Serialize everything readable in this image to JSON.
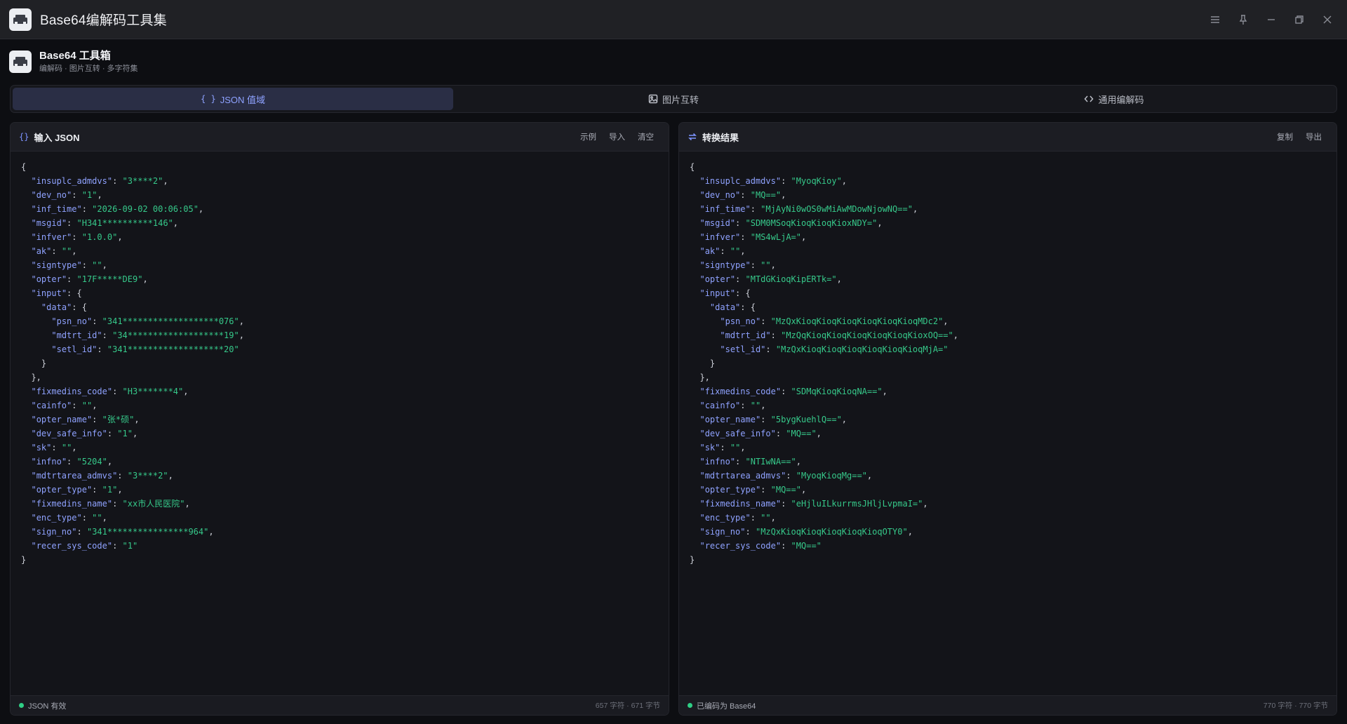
{
  "window": {
    "title": "Base64编解码工具集",
    "controls": [
      "menu-icon",
      "pin-icon",
      "minimize-icon",
      "restore-icon",
      "close-icon"
    ]
  },
  "header": {
    "title": "Base64 工具箱",
    "subtitle": "编解码 · 图片互转 · 多字符集"
  },
  "tabs": [
    {
      "label": "JSON 值域",
      "icon": "braces-icon",
      "active": true
    },
    {
      "label": "图片互转",
      "icon": "image-icon",
      "active": false
    },
    {
      "label": "通用编解码",
      "icon": "code-icon",
      "active": false
    }
  ],
  "left_panel": {
    "icon": "braces-icon",
    "title": "输入 JSON",
    "actions": [
      "示例",
      "导入",
      "清空"
    ],
    "status": "JSON 有效",
    "stats": "657 字符 · 671 字节",
    "lines": [
      {
        "indent": 0,
        "text": "{"
      },
      {
        "indent": 1,
        "key": "insuplc_admdvs",
        "value": "3****2",
        "tail": ","
      },
      {
        "indent": 1,
        "key": "dev_no",
        "value": "1",
        "tail": ","
      },
      {
        "indent": 1,
        "key": "inf_time",
        "value": "2026-09-02 00:06:05",
        "tail": ","
      },
      {
        "indent": 1,
        "key": "msgid",
        "value": "H341**********146",
        "tail": ","
      },
      {
        "indent": 1,
        "key": "infver",
        "value": "1.0.0",
        "tail": ","
      },
      {
        "indent": 1,
        "key": "ak",
        "value": "",
        "tail": ","
      },
      {
        "indent": 1,
        "key": "signtype",
        "value": "",
        "tail": ","
      },
      {
        "indent": 1,
        "key": "opter",
        "value": "17F*****DE9",
        "tail": ","
      },
      {
        "indent": 1,
        "key": "input",
        "open": "{"
      },
      {
        "indent": 2,
        "key": "data",
        "open": "{"
      },
      {
        "indent": 3,
        "key": "psn_no",
        "value": "341*******************076",
        "tail": ","
      },
      {
        "indent": 3,
        "key": "mdtrt_id",
        "value": "34*******************19",
        "tail": ","
      },
      {
        "indent": 3,
        "key": "setl_id",
        "value": "341*******************20"
      },
      {
        "indent": 2,
        "text": "}"
      },
      {
        "indent": 1,
        "text": "},"
      },
      {
        "indent": 1,
        "key": "fixmedins_code",
        "value": "H3*******4",
        "tail": ","
      },
      {
        "indent": 1,
        "key": "cainfo",
        "value": "",
        "tail": ","
      },
      {
        "indent": 1,
        "key": "opter_name",
        "value": "张*硕",
        "tail": ","
      },
      {
        "indent": 1,
        "key": "dev_safe_info",
        "value": "1",
        "tail": ","
      },
      {
        "indent": 1,
        "key": "sk",
        "value": "",
        "tail": ","
      },
      {
        "indent": 1,
        "key": "infno",
        "value": "5204",
        "tail": ","
      },
      {
        "indent": 1,
        "key": "mdtrtarea_admvs",
        "value": "3****2",
        "tail": ","
      },
      {
        "indent": 1,
        "key": "opter_type",
        "value": "1",
        "tail": ","
      },
      {
        "indent": 1,
        "key": "fixmedins_name",
        "value": "xx市人民医院",
        "tail": ","
      },
      {
        "indent": 1,
        "key": "enc_type",
        "value": "",
        "tail": ","
      },
      {
        "indent": 1,
        "key": "sign_no",
        "value": "341****************964",
        "tail": ","
      },
      {
        "indent": 1,
        "key": "recer_sys_code",
        "value": "1"
      },
      {
        "indent": 0,
        "text": "}"
      }
    ]
  },
  "right_panel": {
    "icon": "swap-icon",
    "title": "转换结果",
    "actions": [
      "复制",
      "导出"
    ],
    "status": "已编码为 Base64",
    "stats": "770 字符 · 770 字节",
    "lines": [
      {
        "indent": 0,
        "text": "{"
      },
      {
        "indent": 1,
        "key": "insuplc_admdvs",
        "value": "MyoqKioy",
        "tail": ","
      },
      {
        "indent": 1,
        "key": "dev_no",
        "value": "MQ==",
        "tail": ","
      },
      {
        "indent": 1,
        "key": "inf_time",
        "value": "MjAyNi0wOS0wMiAwMDowNjowNQ==",
        "tail": ","
      },
      {
        "indent": 1,
        "key": "msgid",
        "value": "SDM0MSoqKioqKioqKioxNDY=",
        "tail": ","
      },
      {
        "indent": 1,
        "key": "infver",
        "value": "MS4wLjA=",
        "tail": ","
      },
      {
        "indent": 1,
        "key": "ak",
        "value": "",
        "tail": ","
      },
      {
        "indent": 1,
        "key": "signtype",
        "value": "",
        "tail": ","
      },
      {
        "indent": 1,
        "key": "opter",
        "value": "MTdGKioqKipERTk=",
        "tail": ","
      },
      {
        "indent": 1,
        "key": "input",
        "open": "{"
      },
      {
        "indent": 2,
        "key": "data",
        "open": "{"
      },
      {
        "indent": 3,
        "key": "psn_no",
        "value": "MzQxKioqKioqKioqKioqKioqKioqMDc2",
        "tail": ","
      },
      {
        "indent": 3,
        "key": "mdtrt_id",
        "value": "MzQqKioqKioqKioqKioqKioqKioxOQ==",
        "tail": ","
      },
      {
        "indent": 3,
        "key": "setl_id",
        "value": "MzQxKioqKioqKioqKioqKioqKioqMjA="
      },
      {
        "indent": 2,
        "text": "}"
      },
      {
        "indent": 1,
        "text": "},"
      },
      {
        "indent": 1,
        "key": "fixmedins_code",
        "value": "SDMqKioqKioqNA==",
        "tail": ","
      },
      {
        "indent": 1,
        "key": "cainfo",
        "value": "",
        "tail": ","
      },
      {
        "indent": 1,
        "key": "opter_name",
        "value": "5bygKuehlQ==",
        "tail": ","
      },
      {
        "indent": 1,
        "key": "dev_safe_info",
        "value": "MQ==",
        "tail": ","
      },
      {
        "indent": 1,
        "key": "sk",
        "value": "",
        "tail": ","
      },
      {
        "indent": 1,
        "key": "infno",
        "value": "NTIwNA==",
        "tail": ","
      },
      {
        "indent": 1,
        "key": "mdtrtarea_admvs",
        "value": "MyoqKioqMg==",
        "tail": ","
      },
      {
        "indent": 1,
        "key": "opter_type",
        "value": "MQ==",
        "tail": ","
      },
      {
        "indent": 1,
        "key": "fixmedins_name",
        "value": "eHjluILkurrmsJHljLvpmaI=",
        "tail": ","
      },
      {
        "indent": 1,
        "key": "enc_type",
        "value": "",
        "tail": ","
      },
      {
        "indent": 1,
        "key": "sign_no",
        "value": "MzQxKioqKioqKioqKioqKioqOTY0",
        "tail": ","
      },
      {
        "indent": 1,
        "key": "recer_sys_code",
        "value": "MQ=="
      },
      {
        "indent": 0,
        "text": "}"
      }
    ]
  },
  "colors": {
    "accent": "#8ea2ff",
    "string": "#36c98a",
    "key": "#8fa2ff",
    "status_dot": "#2fcf85"
  }
}
